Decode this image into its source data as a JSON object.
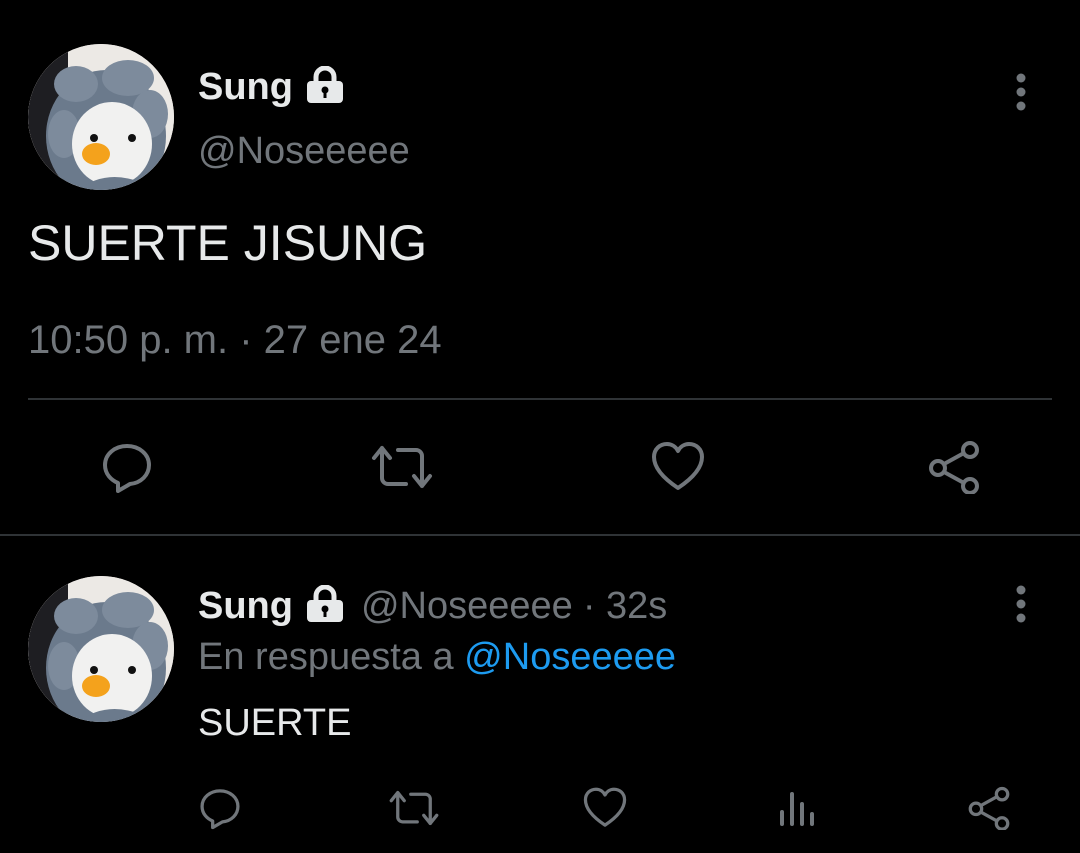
{
  "tweet": {
    "author_name": "Sung",
    "author_handle": "@Noseeeee",
    "text": "SUERTE JISUNG",
    "timestamp": "10:50 p. m. · 27 ene 24",
    "locked": true
  },
  "reply": {
    "author_name": "Sung",
    "author_handle": "@Noseeeee",
    "time_ago": "· 32s",
    "reply_prefix": "En respuesta a",
    "reply_to": "@Noseeeee",
    "text": "SUERTE",
    "locked": true
  },
  "actions": {
    "main": [
      "reply-icon",
      "retweet-icon",
      "like-icon",
      "share-icon"
    ],
    "reply": [
      "reply-icon",
      "retweet-icon",
      "like-icon",
      "analytics-icon",
      "share-icon"
    ]
  },
  "colors": {
    "background": "#000000",
    "text": "#e7e9ea",
    "muted": "#71767b",
    "link": "#1d9bf0",
    "divider": "#2f3336"
  }
}
